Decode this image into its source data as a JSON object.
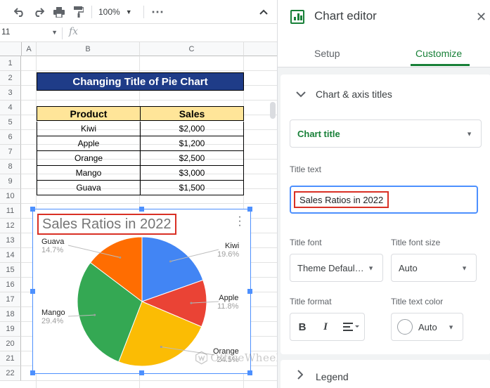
{
  "toolbar": {
    "undo_icon": "undo-icon",
    "redo_icon": "redo-icon",
    "print_icon": "print-icon",
    "paint_format_icon": "paint-format-icon",
    "zoom": "100%",
    "more_icon": "more-icon",
    "collapse_icon": "chevron-up-icon"
  },
  "formula_bar": {
    "name_box": "11",
    "fx": "fx"
  },
  "grid": {
    "columns": [
      "A",
      "B",
      "C"
    ],
    "rows": [
      "1",
      "2",
      "3",
      "4",
      "5",
      "6",
      "7",
      "8",
      "9",
      "10",
      "11",
      "12",
      "13",
      "14",
      "15",
      "16",
      "17",
      "18",
      "19",
      "20",
      "21",
      "22"
    ]
  },
  "sheet": {
    "title": "Changing Title of Pie Chart",
    "table": {
      "headers": [
        "Product",
        "Sales"
      ],
      "rows": [
        [
          "Kiwi",
          "$2,000"
        ],
        [
          "Apple",
          "$1,200"
        ],
        [
          "Orange",
          "$2,500"
        ],
        [
          "Mango",
          "$3,000"
        ],
        [
          "Guava",
          "$1,500"
        ]
      ]
    }
  },
  "chart_data": {
    "type": "pie",
    "title": "Sales Ratios in 2022",
    "slices": [
      {
        "label": "Kiwi",
        "pct_label": "19.6%",
        "value": 2000,
        "color": "#4285f4"
      },
      {
        "label": "Apple",
        "pct_label": "11.8%",
        "value": 1200,
        "color": "#ea4335"
      },
      {
        "label": "Orange",
        "pct_label": "24.5%",
        "value": 2500,
        "color": "#fbbc04"
      },
      {
        "label": "Mango",
        "pct_label": "29.4%",
        "value": 3000,
        "color": "#34a853"
      },
      {
        "label": "Guava",
        "pct_label": "14.7%",
        "value": 1500,
        "color": "#ff6d01"
      }
    ]
  },
  "watermark": {
    "text": "OfficeWheel"
  },
  "editor": {
    "title": "Chart editor",
    "tabs": {
      "setup": "Setup",
      "customize": "Customize"
    },
    "section_title": "Chart & axis titles",
    "chart_title_select": "Chart title",
    "title_text_label": "Title text",
    "title_text_value": "Sales Ratios in 2022",
    "title_font_label": "Title font",
    "title_font_value": "Theme Defaul…",
    "title_font_size_label": "Title font size",
    "title_font_size_value": "Auto",
    "title_format_label": "Title format",
    "title_text_color_label": "Title text color",
    "title_text_color_value": "Auto",
    "legend_title": "Legend"
  }
}
